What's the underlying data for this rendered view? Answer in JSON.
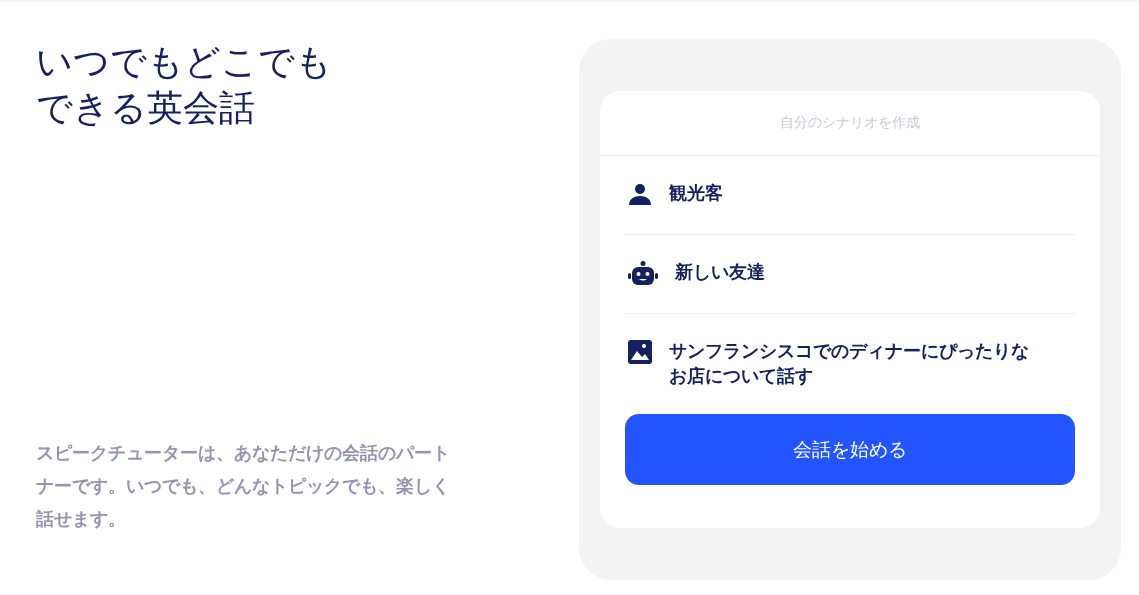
{
  "hero": {
    "title": "いつでもどこでもできる英会話",
    "description": "スピークチューターは、あなただけの会話のパートナーです。いつでも、どんなトピックでも、楽しく話せます。"
  },
  "scenario_card": {
    "header": "自分のシナリオを作成",
    "items": [
      {
        "kind": "person",
        "label": "観光客"
      },
      {
        "kind": "robot",
        "label": "新しい友達"
      },
      {
        "kind": "image",
        "label": "サンフランシスコでのディナーにぴったりなお店について話す"
      }
    ],
    "button": "会話を始める"
  }
}
